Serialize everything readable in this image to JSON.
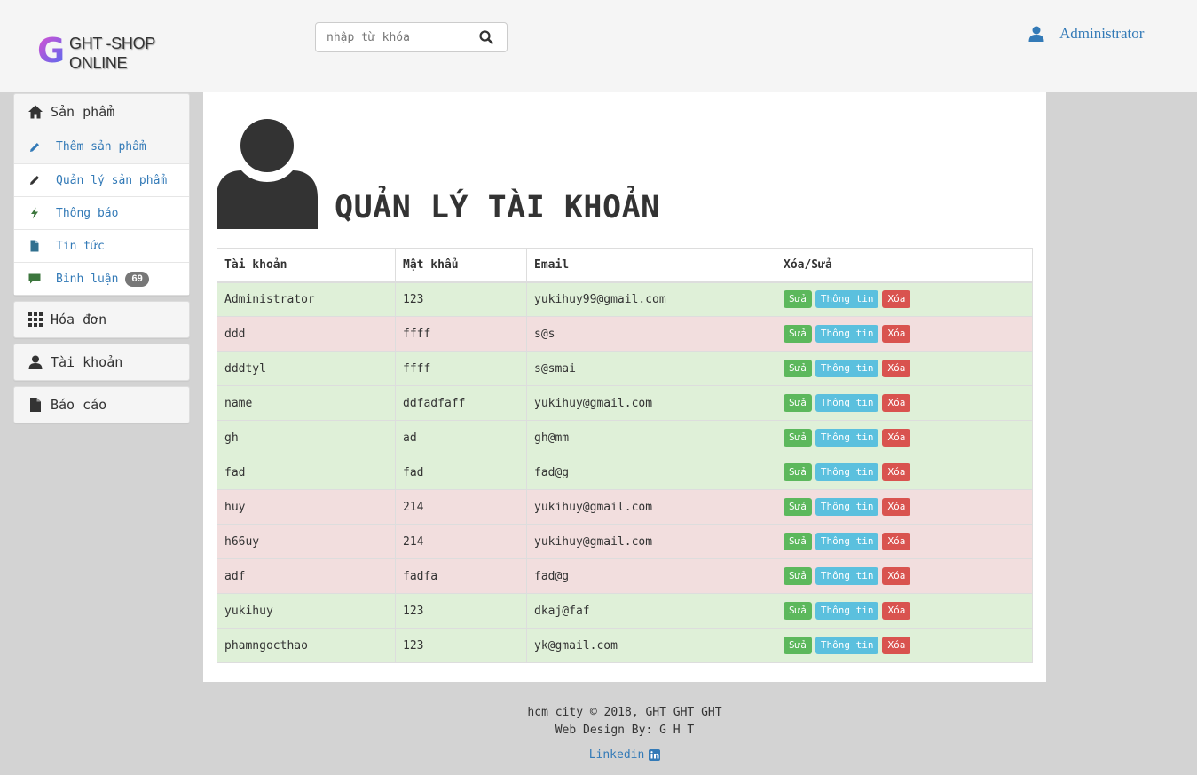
{
  "header": {
    "logo_letter": "G",
    "logo_line1": "GHT -SHOP",
    "logo_line2": "ONLINE",
    "search_placeholder": "nhập từ khóa",
    "user_name": "Administrator"
  },
  "sidebar": {
    "products": {
      "label": "Sản phẩm",
      "items": [
        {
          "label": "Thêm sản phẩm",
          "icon": "pencil-icon",
          "color": "#337ab7"
        },
        {
          "label": "Quản lý sản phẩm",
          "icon": "pencil-icon",
          "color": "#333333"
        },
        {
          "label": "Thông báo",
          "icon": "flash-icon",
          "color": "#3c763d"
        },
        {
          "label": "Tin tức",
          "icon": "file-icon",
          "color": "#31708f"
        },
        {
          "label": "Bình luận",
          "icon": "comment-icon",
          "color": "#3c763d",
          "badge": "69"
        }
      ]
    },
    "invoices_label": "Hóa đơn",
    "accounts_label": "Tài khoản",
    "reports_label": "Báo cáo"
  },
  "main": {
    "title": "QUẢN LÝ TÀI KHOẢN",
    "columns": [
      "Tài khoản",
      "Mật khẩu",
      "Email",
      "Xóa/Sửa"
    ],
    "buttons": {
      "edit": "Sửa",
      "info": "Thông tin",
      "delete": "Xóa"
    },
    "rows": [
      {
        "account": "Administrator",
        "password": "123",
        "email": "yukihuy99@gmail.com",
        "status": "success"
      },
      {
        "account": "ddd",
        "password": "ffff",
        "email": "s@s",
        "status": "danger"
      },
      {
        "account": "dddtyl",
        "password": "ffff",
        "email": "s@smai",
        "status": "success"
      },
      {
        "account": "name",
        "password": "ddfadfaff",
        "email": "yukihuy@gmail.com",
        "status": "success"
      },
      {
        "account": "gh",
        "password": "ad",
        "email": "gh@mm",
        "status": "success"
      },
      {
        "account": "fad",
        "password": "fad",
        "email": "fad@g",
        "status": "success"
      },
      {
        "account": "huy",
        "password": "214",
        "email": "yukihuy@gmail.com",
        "status": "danger"
      },
      {
        "account": "h66uy",
        "password": "214",
        "email": "yukihuy@gmail.com",
        "status": "danger"
      },
      {
        "account": "adf",
        "password": "fadfa",
        "email": "fad@g",
        "status": "danger"
      },
      {
        "account": "yukihuy",
        "password": "123",
        "email": "dkaj@faf",
        "status": "success"
      },
      {
        "account": "phamngocthao",
        "password": "123",
        "email": "yk@gmail.com",
        "status": "success"
      }
    ]
  },
  "footer": {
    "line1": "hcm city © 2018, GHT GHT GHT",
    "line2": "Web Design By: G H T",
    "link": "Linkedin"
  },
  "colors": {
    "header_bg": "#f5f5f5",
    "page_bg": "#d3d3d3",
    "link": "#337ab7",
    "success_row": "#dff0d8",
    "danger_row": "#f2dede",
    "btn_edit": "#5cb85c",
    "btn_info": "#5bc0de",
    "btn_delete": "#d9534f"
  }
}
